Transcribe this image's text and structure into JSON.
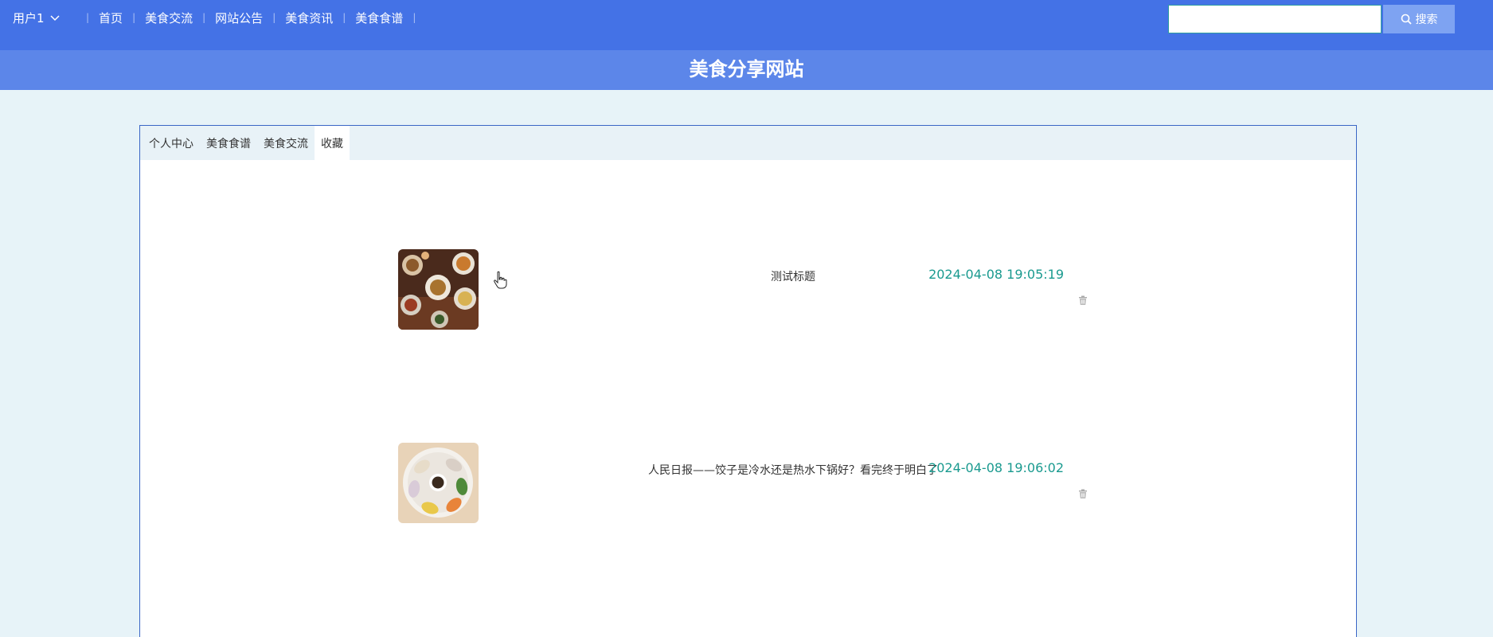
{
  "header": {
    "user_label": "用户1",
    "nav": [
      "首页",
      "美食交流",
      "网站公告",
      "美食资讯",
      "美食食谱"
    ],
    "search": {
      "value": "",
      "placeholder": "",
      "button_label": "搜索"
    },
    "colors": {
      "topbar": "#4472e6",
      "banner": "#5c86e9",
      "search_button": "#7ea3f2"
    }
  },
  "banner": {
    "title": "美食分享网站"
  },
  "tabs": [
    {
      "label": "个人中心",
      "active": false
    },
    {
      "label": "美食食谱",
      "active": false
    },
    {
      "label": "美食交流",
      "active": false
    },
    {
      "label": "收藏",
      "active": true
    }
  ],
  "favorites": [
    {
      "title": "测试标题",
      "time": "2024-04-08 19:05:19",
      "image": "food-platter-photo",
      "delete_icon": "trash-icon"
    },
    {
      "title": "人民日报——饺子是冷水还是热水下锅好？看完终于明白了",
      "time": "2024-04-08 19:06:02",
      "image": "dumplings-plate-photo",
      "delete_icon": "trash-icon"
    }
  ],
  "theme": {
    "accent_time": "#1a9a8f",
    "panel_border": "#3a66c6",
    "page_bg": "#e7f3f8"
  }
}
